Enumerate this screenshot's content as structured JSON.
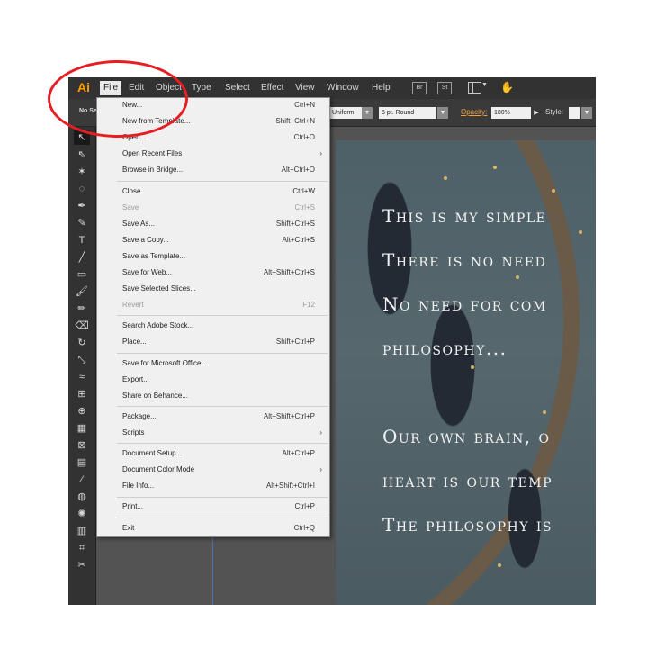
{
  "logo": "Ai",
  "menubar": {
    "items": [
      "File",
      "Edit",
      "Object",
      "Type",
      "Select",
      "Effect",
      "View",
      "Window",
      "Help"
    ],
    "bridge_button": "Br",
    "stock_button": "St"
  },
  "controlbar": {
    "selection": "No Se",
    "uniform": "Uniform",
    "brush": "5 pt. Round",
    "opacity_label": "Opacity:",
    "opacity_value": "100%",
    "style_label": "Style:"
  },
  "file_menu": {
    "items": [
      {
        "label": "New...",
        "shortcut": "Ctrl+N"
      },
      {
        "label": "New from Template...",
        "shortcut": "Shift+Ctrl+N"
      },
      {
        "label": "Open...",
        "shortcut": "Ctrl+O"
      },
      {
        "label": "Open Recent Files",
        "shortcut": ""
      },
      {
        "label": "Browse in Bridge...",
        "shortcut": "Alt+Ctrl+O"
      },
      {
        "label": "Close",
        "shortcut": "Ctrl+W"
      },
      {
        "label": "Save",
        "shortcut": "Ctrl+S"
      },
      {
        "label": "Save As...",
        "shortcut": "Shift+Ctrl+S"
      },
      {
        "label": "Save a Copy...",
        "shortcut": "Alt+Ctrl+S"
      },
      {
        "label": "Save as Template...",
        "shortcut": ""
      },
      {
        "label": "Save for Web...",
        "shortcut": "Alt+Shift+Ctrl+S"
      },
      {
        "label": "Save Selected Slices...",
        "shortcut": ""
      },
      {
        "label": "Revert",
        "shortcut": "F12"
      },
      {
        "label": "Search Adobe Stock...",
        "shortcut": ""
      },
      {
        "label": "Place...",
        "shortcut": "Shift+Ctrl+P"
      },
      {
        "label": "Save for Microsoft Office...",
        "shortcut": ""
      },
      {
        "label": "Export...",
        "shortcut": ""
      },
      {
        "label": "Share on Behance...",
        "shortcut": ""
      },
      {
        "label": "Package...",
        "shortcut": "Alt+Shift+Ctrl+P"
      },
      {
        "label": "Scripts",
        "shortcut": ""
      },
      {
        "label": "Document Setup...",
        "shortcut": "Alt+Ctrl+P"
      },
      {
        "label": "Document Color Mode",
        "shortcut": ""
      },
      {
        "label": "File Info...",
        "shortcut": "Alt+Shift+Ctrl+I"
      },
      {
        "label": "Print...",
        "shortcut": "Ctrl+P"
      },
      {
        "label": "Exit",
        "shortcut": "Ctrl+Q"
      }
    ]
  },
  "artboard": {
    "lines": [
      "This is my simple",
      "There is no need",
      "No need for com",
      "philosophy...",
      "",
      "Our own brain, o",
      "heart is our temp",
      "The philosophy is"
    ]
  },
  "tools": [
    "selection-tool",
    "direct-selection-tool",
    "magic-wand-tool",
    "lasso-tool",
    "pen-tool",
    "curvature-tool",
    "type-tool",
    "line-tool",
    "rectangle-tool",
    "paintbrush-tool",
    "pencil-tool",
    "eraser-tool",
    "rotate-tool",
    "scale-tool",
    "width-tool",
    "free-transform-tool",
    "shape-builder-tool",
    "perspective-grid-tool",
    "mesh-tool",
    "gradient-tool",
    "eyedropper-tool",
    "blend-tool",
    "symbol-sprayer-tool",
    "column-graph-tool",
    "artboard-tool",
    "slice-tool"
  ],
  "colors": {
    "annotation_circle": "#e61e24",
    "ai_logo": "#ff9a00",
    "opacity_link": "#f2a33a",
    "guide": "#4e6fb4"
  }
}
